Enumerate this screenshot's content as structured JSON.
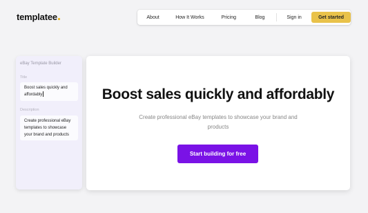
{
  "brand": {
    "logo_text": "templatee"
  },
  "nav": {
    "items": [
      {
        "label": "About"
      },
      {
        "label": "How It Works"
      },
      {
        "label": "Pricing"
      },
      {
        "label": "Blog"
      }
    ],
    "signin_label": "Sign in",
    "cta_label": "Get started"
  },
  "sidebar": {
    "title": "eBay Template Builder",
    "title_field": {
      "label": "Title",
      "value": "Boost sales quickly and affordably"
    },
    "description_field": {
      "label": "Description",
      "value": "Create professional eBay templates to showcase your brand and products"
    }
  },
  "hero": {
    "title": "Boost sales quickly and affordably",
    "subtitle": "Create professional eBay templates to showcase your brand and products",
    "cta_label": "Start building for free"
  },
  "colors": {
    "accent_yellow": "#e9c24a",
    "cta_purple": "#7a12e6",
    "sidebar_bg": "#f1effb"
  }
}
